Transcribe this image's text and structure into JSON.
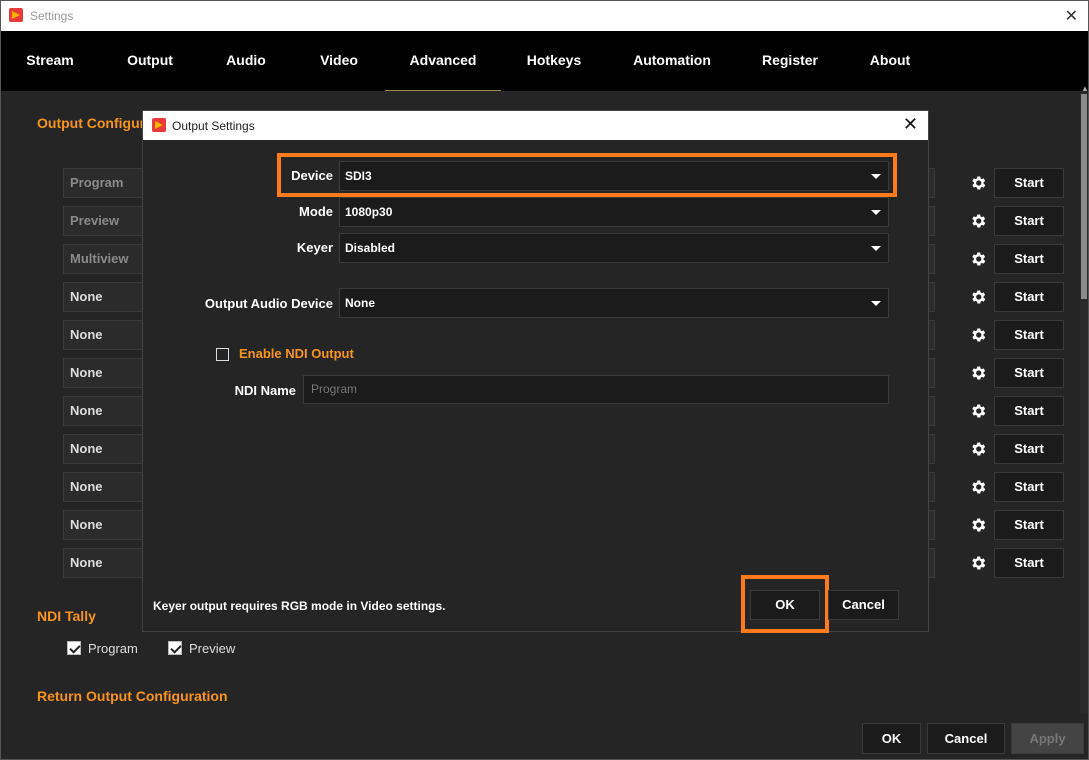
{
  "window": {
    "title": "Settings"
  },
  "tabs": [
    {
      "label": "Stream"
    },
    {
      "label": "Output"
    },
    {
      "label": "Audio"
    },
    {
      "label": "Video"
    },
    {
      "label": "Advanced"
    },
    {
      "label": "Hotkeys"
    },
    {
      "label": "Automation"
    },
    {
      "label": "Register"
    },
    {
      "label": "About"
    }
  ],
  "active_tab": "Advanced",
  "output_config": {
    "title": "Output Configura",
    "rows": [
      {
        "source": "Program",
        "start": "Start"
      },
      {
        "source": "Preview",
        "start": "Start"
      },
      {
        "source": "Multiview",
        "start": "Start"
      },
      {
        "source": "None",
        "start": "Start"
      },
      {
        "source": "None",
        "start": "Start"
      },
      {
        "source": "None",
        "start": "Start"
      },
      {
        "source": "None",
        "start": "Start"
      },
      {
        "source": "None",
        "start": "Start"
      },
      {
        "source": "None",
        "start": "Start"
      },
      {
        "source": "None",
        "start": "Start"
      },
      {
        "source": "None",
        "start": "Start"
      }
    ]
  },
  "ndi_tally": {
    "title": "NDI Tally",
    "program": "Program",
    "preview": "Preview",
    "program_checked": true,
    "preview_checked": true
  },
  "return_output": {
    "title": "Return Output Configuration"
  },
  "footer": {
    "ok": "OK",
    "cancel": "Cancel",
    "apply": "Apply"
  },
  "dialog": {
    "title": "Output Settings",
    "device_label": "Device",
    "device_value": "SDI3",
    "mode_label": "Mode",
    "mode_value": "1080p30",
    "keyer_label": "Keyer",
    "keyer_value": "Disabled",
    "audio_label": "Output Audio Device",
    "audio_value": "None",
    "ndi_enable_label": "Enable NDI Output",
    "ndi_enabled": false,
    "ndi_name_label": "NDI Name",
    "ndi_name_placeholder": "Program",
    "note": "Keyer output requires RGB mode in Video settings.",
    "ok": "OK",
    "cancel": "Cancel"
  },
  "colors": {
    "accent": "#f7941d",
    "highlight": "#ff7a1a",
    "background": "#252525"
  }
}
